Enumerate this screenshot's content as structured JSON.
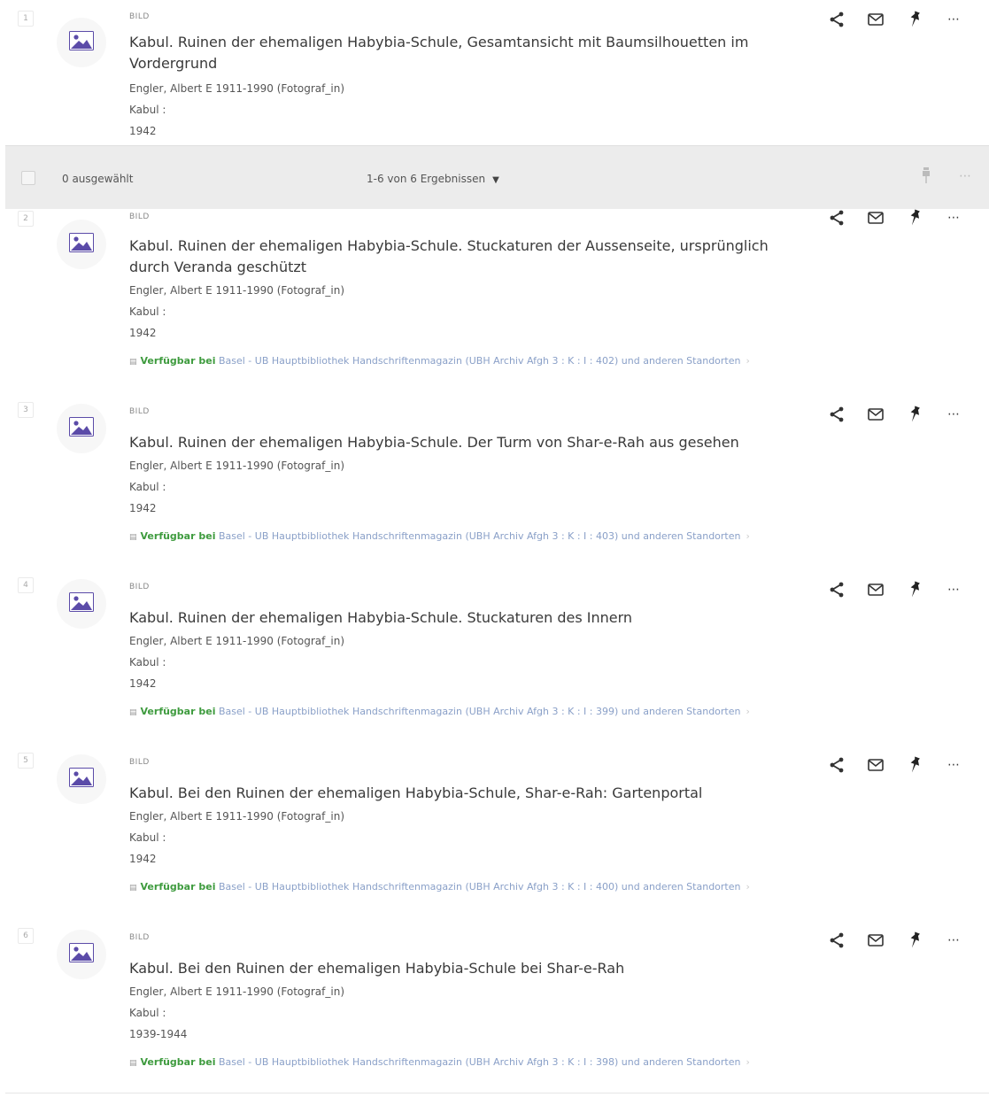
{
  "toolbar": {
    "selected_label": "0 ausgewählt",
    "results_label": "1-6 von 6 Ergebnissen"
  },
  "records": [
    {
      "index": "1",
      "type": "BILD",
      "title": "Kabul. Ruinen der ehemaligen Habybia-Schule, Gesamtansicht mit Baumsilhouetten im Vordergrund",
      "creator": "Engler, Albert E 1911-1990 (Fotograf_in)",
      "place": "Kabul :",
      "date": "1942"
    },
    {
      "index": "2",
      "type": "BILD",
      "title": "Kabul. Ruinen der ehemaligen Habybia-Schule. Stuckaturen der Aussenseite, ursprünglich durch Veranda geschützt",
      "creator": "Engler, Albert E 1911-1990 (Fotograf_in)",
      "place": "Kabul :",
      "date": "1942",
      "availability": {
        "status": "Verfügbar bei",
        "library": "Basel - UB Hauptbibliothek",
        "location": "Handschriftenmagazin (UBH Archiv Afgh 3 : K : I : 402) und anderen Standorten"
      }
    },
    {
      "index": "3",
      "type": "BILD",
      "title": "Kabul. Ruinen der ehemaligen Habybia-Schule. Der Turm von Shar-e-Rah aus gesehen",
      "creator": "Engler, Albert E 1911-1990 (Fotograf_in)",
      "place": "Kabul :",
      "date": "1942",
      "availability": {
        "status": "Verfügbar bei",
        "library": "Basel - UB Hauptbibliothek",
        "location": "Handschriftenmagazin (UBH Archiv Afgh 3 : K : I : 403) und anderen Standorten"
      }
    },
    {
      "index": "4",
      "type": "BILD",
      "title": "Kabul. Ruinen der ehemaligen Habybia-Schule. Stuckaturen des Innern",
      "creator": "Engler, Albert E 1911-1990 (Fotograf_in)",
      "place": "Kabul :",
      "date": "1942",
      "availability": {
        "status": "Verfügbar bei",
        "library": "Basel - UB Hauptbibliothek",
        "location": "Handschriftenmagazin (UBH Archiv Afgh 3 : K : I : 399) und anderen Standorten"
      }
    },
    {
      "index": "5",
      "type": "BILD",
      "title": "Kabul. Bei den Ruinen der ehemaligen Habybia-Schule, Shar-e-Rah: Gartenportal",
      "creator": "Engler, Albert E 1911-1990 (Fotograf_in)",
      "place": "Kabul :",
      "date": "1942",
      "availability": {
        "status": "Verfügbar bei",
        "library": "Basel - UB Hauptbibliothek",
        "location": "Handschriftenmagazin (UBH Archiv Afgh 3 : K : I : 400) und anderen Standorten"
      }
    },
    {
      "index": "6",
      "type": "BILD",
      "title": "Kabul. Bei den Ruinen der ehemaligen Habybia-Schule bei Shar-e-Rah",
      "creator": "Engler, Albert E 1911-1990 (Fotograf_in)",
      "place": "Kabul :",
      "date": "1939-1944",
      "availability": {
        "status": "Verfügbar bei",
        "library": "Basel - UB Hauptbibliothek",
        "location": "Handschriftenmagazin (UBH Archiv Afgh 3 : K : I : 398) und anderen Standorten"
      }
    }
  ],
  "icons": {
    "thumbnail": "image-icon",
    "share": "share-icon",
    "email": "email-icon",
    "pin": "pin-icon",
    "more": "more-icon",
    "availability": "document-icon"
  },
  "colors": {
    "accent": "#5b4ba8",
    "available": "#3e9b3e",
    "toolbar_bg": "#ececec"
  }
}
